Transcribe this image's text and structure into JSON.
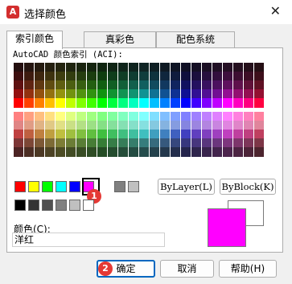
{
  "window": {
    "title": "选择颜色",
    "app_icon_letter": "A",
    "close_symbol": "✕"
  },
  "tabs": [
    {
      "label": "索引颜色",
      "active": true
    },
    {
      "label": "真彩色",
      "active": false
    },
    {
      "label": "配色系统",
      "active": false
    }
  ],
  "aci_label": "AutoCAD 颜色索引 (ACI):",
  "standard_colors": [
    "#ff0000",
    "#ffff00",
    "#00ff00",
    "#00ffff",
    "#0000ff",
    "#ff00ff"
  ],
  "gray_colors": [
    "#000000",
    "#333333",
    "#505050",
    "#808080",
    "#c0c0c0",
    "#ffffff"
  ],
  "extra_grays": [
    "#808080",
    "#c0c0c0"
  ],
  "selected_color_name": "magenta",
  "buttons": {
    "bylayer": "ByLayer(L)",
    "byblock": "ByBlock(K)",
    "ok": "确定",
    "cancel": "取消",
    "help": "帮助(H)"
  },
  "color_field": {
    "label": "颜色(C):",
    "value": "洋红"
  },
  "preview": {
    "old_color": "#ffffff",
    "new_color": "#ff00ff"
  },
  "badges": [
    "1",
    "2"
  ]
}
